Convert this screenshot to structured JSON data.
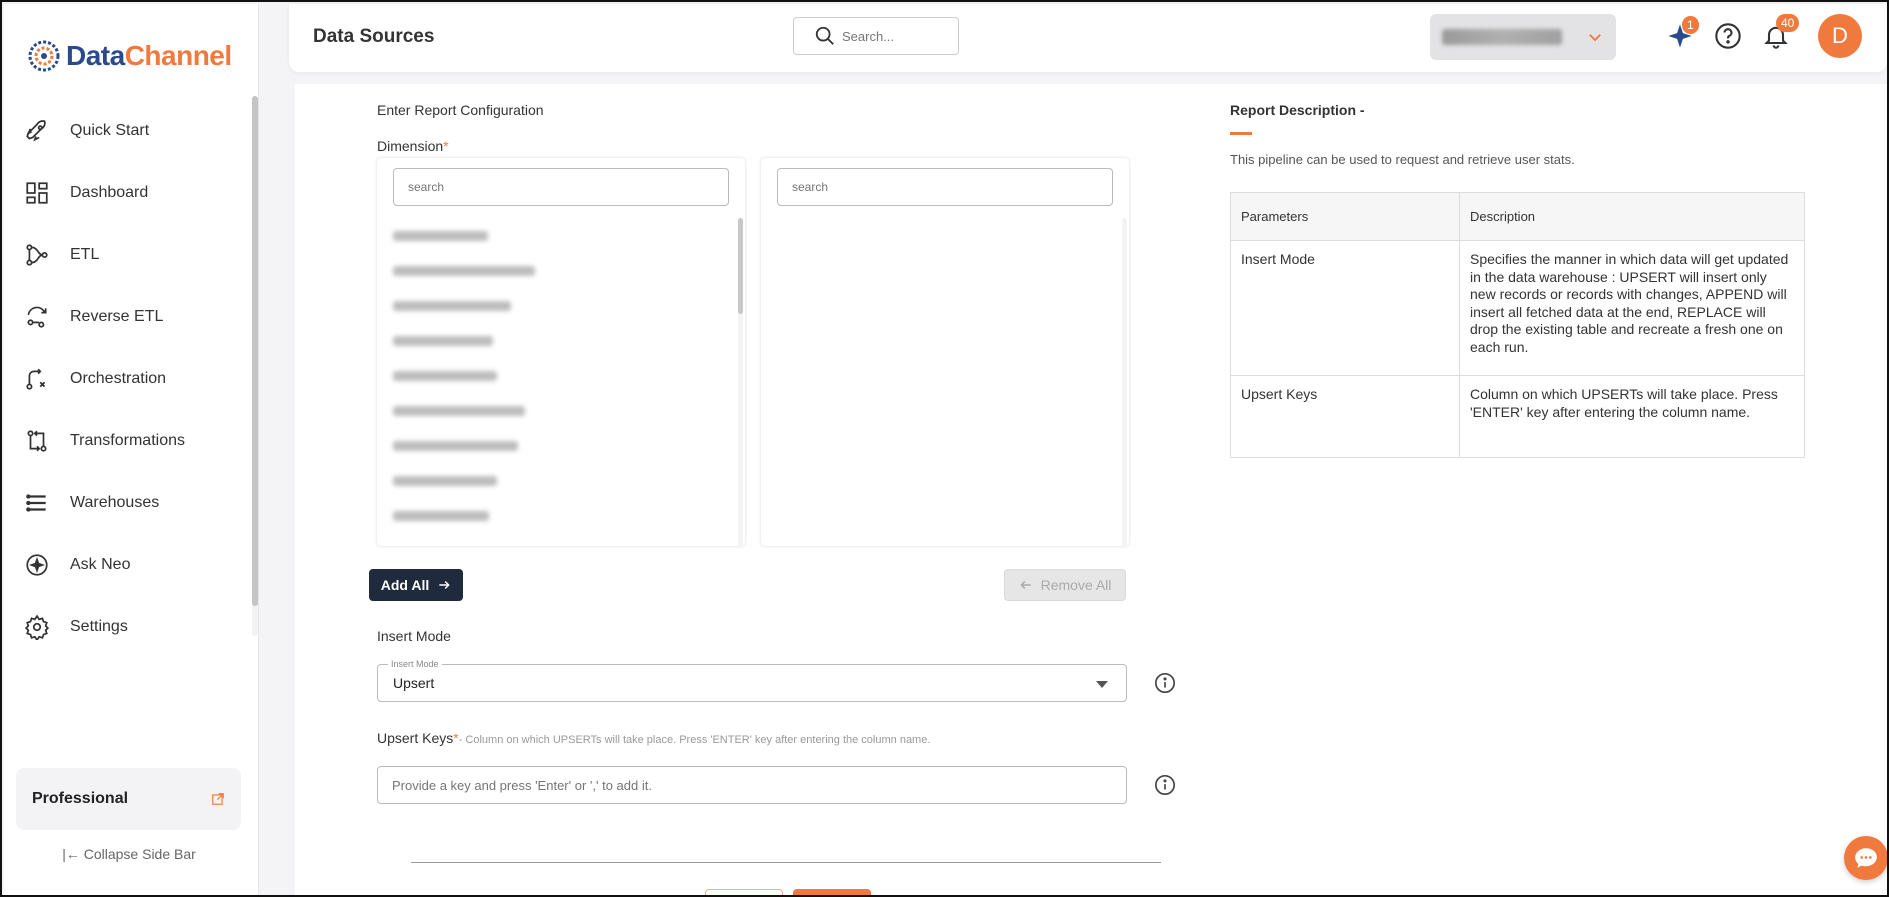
{
  "brand": {
    "name_part1": "Data",
    "name_part2": "Channel",
    "accent": "#f07a3e",
    "primary": "#2b4a8c"
  },
  "sidebar": {
    "items": [
      {
        "label": "Quick Start",
        "icon": "rocket-icon"
      },
      {
        "label": "Dashboard",
        "icon": "dashboard-icon"
      },
      {
        "label": "ETL",
        "icon": "etl-icon"
      },
      {
        "label": "Reverse ETL",
        "icon": "reverse-etl-icon"
      },
      {
        "label": "Orchestration",
        "icon": "orchestration-icon"
      },
      {
        "label": "Transformations",
        "icon": "transformations-icon"
      },
      {
        "label": "Warehouses",
        "icon": "warehouses-icon"
      },
      {
        "label": "Ask Neo",
        "icon": "sparkle-icon"
      },
      {
        "label": "Settings",
        "icon": "gear-icon"
      }
    ],
    "plan_label": "Professional",
    "collapse_label": "Collapse Side Bar"
  },
  "header": {
    "title": "Data Sources",
    "search_placeholder": "Search...",
    "sparkle_badge": "1",
    "notification_badge": "40",
    "avatar_initial": "D"
  },
  "config": {
    "section_title": "Enter Report Configuration",
    "dimension_label": "Dimension",
    "required_mark": "*",
    "left_search_placeholder": "search",
    "right_search_placeholder": "search",
    "add_all_label": "Add All",
    "remove_all_label": "Remove All",
    "insert_mode_label": "Insert Mode",
    "insert_mode_legend": "Insert Mode",
    "insert_mode_value": "Upsert",
    "upsert_keys_label": "Upsert Keys",
    "upsert_keys_hint": "- Column on which UPSERTs will take place. Press 'ENTER' key after entering the column name.",
    "upsert_keys_placeholder": "Provide a key and press 'Enter' or ',' to add it."
  },
  "report": {
    "title": "Report Description -",
    "description": "This pipeline can be used to request and retrieve user stats.",
    "columns": [
      "Parameters",
      "Description"
    ],
    "rows": [
      {
        "parameter": "Insert Mode",
        "description": "Specifies the manner in which data will get updated in the data warehouse : UPSERT will insert only new records or records with changes, APPEND will insert all fetched data at the end, REPLACE will drop the existing table and recreate a fresh one on each run."
      },
      {
        "parameter": "Upsert Keys",
        "description": "Column on which UPSERTs will take place. Press 'ENTER' key after entering the column name."
      }
    ]
  }
}
